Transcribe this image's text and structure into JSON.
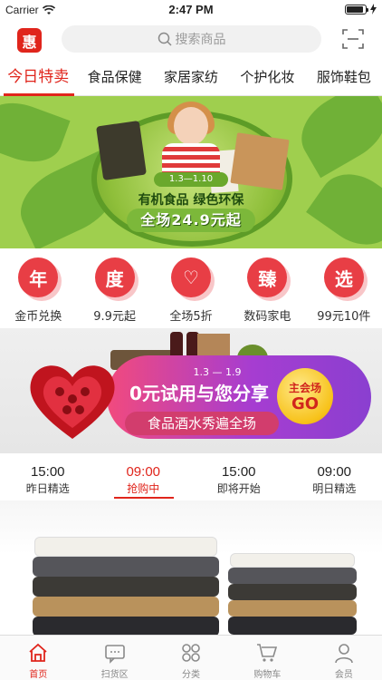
{
  "status_bar": {
    "carrier": "Carrier",
    "time": "2:47 PM"
  },
  "header": {
    "logo_text": "惠",
    "search_placeholder": "搜索商品",
    "icons": {
      "search": "search-icon",
      "scan": "scan-icon"
    }
  },
  "categories": [
    {
      "label": "今日特卖",
      "active": true
    },
    {
      "label": "食品保健",
      "active": false
    },
    {
      "label": "家居家纺",
      "active": false
    },
    {
      "label": "个护化妆",
      "active": false
    },
    {
      "label": "服饰鞋包",
      "active": false
    }
  ],
  "banner1": {
    "date": "1.3—1.10",
    "line1": "有机食品  绿色环保",
    "line2": "全场24.9元起"
  },
  "quick_icons": [
    {
      "glyph": "年",
      "label": "金币兑换"
    },
    {
      "glyph": "度",
      "label": "9.9元起"
    },
    {
      "glyph": "♡",
      "label": "全场5折"
    },
    {
      "glyph": "臻",
      "label": "数码家电"
    },
    {
      "glyph": "选",
      "label": "99元10件"
    }
  ],
  "banner2": {
    "date": "1.3 — 1.9",
    "main": "0元试用与您分享",
    "sub": "食品酒水秀遍全场",
    "go_top": "主会场",
    "go_bottom": "GO"
  },
  "timeline": [
    {
      "time": "15:00",
      "label": "昨日精选",
      "active": false
    },
    {
      "time": "09:00",
      "label": "抢购中",
      "active": true
    },
    {
      "time": "15:00",
      "label": "即将开始",
      "active": false
    },
    {
      "time": "09:00",
      "label": "明日精选",
      "active": false
    }
  ],
  "tabbar": [
    {
      "label": "首页",
      "icon": "home-icon",
      "active": true
    },
    {
      "label": "扫货区",
      "icon": "chat-icon",
      "active": false
    },
    {
      "label": "分类",
      "icon": "grid-icon",
      "active": false
    },
    {
      "label": "购物车",
      "icon": "cart-icon",
      "active": false
    },
    {
      "label": "会员",
      "icon": "user-icon",
      "active": false
    }
  ],
  "colors": {
    "accent": "#e0251c",
    "icon_red": "#e83e45",
    "banner_green": "#9fcf4e"
  }
}
